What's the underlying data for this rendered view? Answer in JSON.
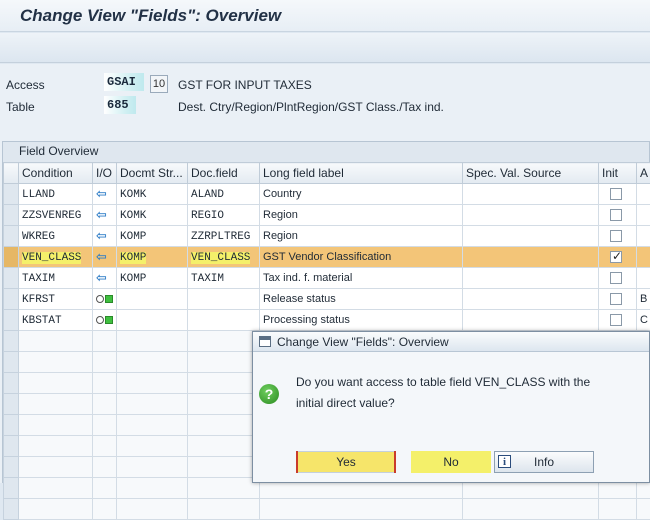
{
  "window": {
    "title": "Change View \"Fields\": Overview"
  },
  "header": {
    "access_label": "Access",
    "access_value": "GSAI",
    "access_number": "10",
    "access_desc": "GST FOR INPUT TAXES",
    "table_label": "Table",
    "table_value": "685",
    "table_desc": "Dest. Ctry/Region/PlntRegion/GST Class./Tax ind."
  },
  "grid": {
    "section_title": "Field Overview",
    "columns": [
      "Condition",
      "I/O",
      "Docmt Str...",
      "Doc.field",
      "Long field label",
      "Spec. Val. Source",
      "Init",
      "A"
    ],
    "rows": [
      {
        "condition": "LLAND",
        "io": "arrow-left-icon",
        "docstr": "KOMK",
        "docfield": "ALAND",
        "label": "Country",
        "spec": "",
        "init": false,
        "a": "",
        "highlight": false
      },
      {
        "condition": "ZZSVENREG",
        "io": "arrow-left-icon",
        "docstr": "KOMK",
        "docfield": "REGIO",
        "label": "Region",
        "spec": "",
        "init": false,
        "a": "",
        "highlight": false
      },
      {
        "condition": "WKREG",
        "io": "arrow-left-icon",
        "docstr": "KOMP",
        "docfield": "ZZRPLTREG",
        "label": "Region",
        "spec": "",
        "init": false,
        "a": "",
        "highlight": false
      },
      {
        "condition": "VEN_CLASS",
        "io": "arrow-left-icon",
        "docstr": "KOMP",
        "docfield": "VEN_CLASS",
        "label": "GST Vendor Classification",
        "spec": "",
        "init": true,
        "a": "",
        "highlight": true
      },
      {
        "condition": "TAXIM",
        "io": "arrow-left-icon",
        "docstr": "KOMP",
        "docfield": "TAXIM",
        "label": "Tax ind. f. material",
        "spec": "",
        "init": false,
        "a": "",
        "highlight": false
      },
      {
        "condition": "KFRST",
        "io": "circle-square-icon",
        "docstr": "",
        "docfield": "",
        "label": "Release status",
        "spec": "",
        "init": false,
        "a": "B",
        "highlight": false
      },
      {
        "condition": "KBSTAT",
        "io": "circle-square-icon",
        "docstr": "",
        "docfield": "",
        "label": "Processing status",
        "spec": "",
        "init": false,
        "a": "C",
        "highlight": false
      }
    ]
  },
  "dialog": {
    "title": "Change View \"Fields\": Overview",
    "message_line1": "Do you want access to table field VEN_CLASS with the",
    "message_line2": "initial direct value?",
    "yes_label": "Yes",
    "no_label": "No",
    "info_label": "Info"
  },
  "colors": {
    "highlight_row": "#f3c578",
    "marker_yellow": "#f4f06a",
    "arrow_blue": "#2f7dc7",
    "status_green": "#3fbf3f"
  }
}
